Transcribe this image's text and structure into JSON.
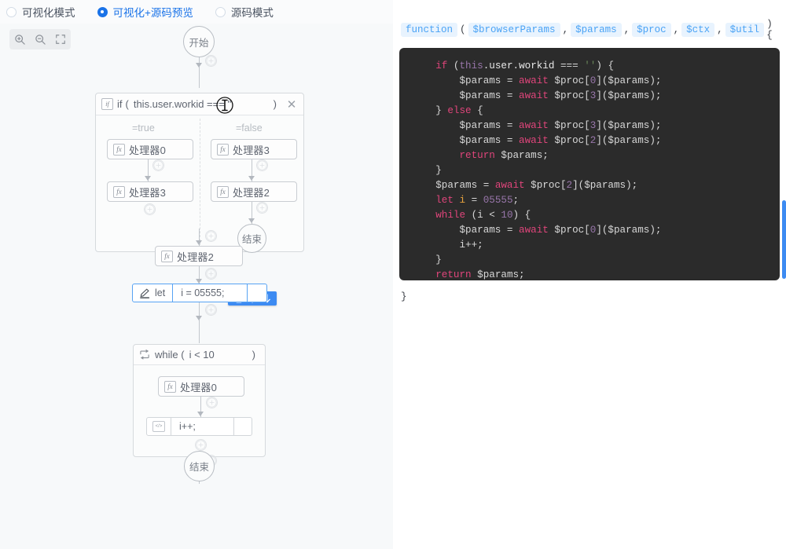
{
  "modes": [
    {
      "label": "可视化模式",
      "selected": false
    },
    {
      "label": "可视化+源码预览",
      "selected": true
    },
    {
      "label": "源码模式",
      "selected": false
    }
  ],
  "toolbar": {
    "zoom_in": "zoom-in",
    "zoom_out": "zoom-out",
    "fit_screen": "fit-screen"
  },
  "flow": {
    "start_label": "开始",
    "end_label": "结束",
    "if": {
      "keyword": "if",
      "paren_open": "(",
      "expression": "this.user.workid === ''",
      "paren_close": ")",
      "close_btn": "✕",
      "true_label": "=true",
      "false_label": "=false",
      "true_branch": [
        {
          "label": "处理器0"
        },
        {
          "label": "处理器3"
        }
      ],
      "false_branch": [
        {
          "label": "处理器3"
        },
        {
          "label": "处理器2"
        }
      ],
      "false_end_label": "结束"
    },
    "after_if_proc": {
      "label": "处理器2"
    },
    "let_stmt": {
      "keyword": "let",
      "value": "i = 05555;"
    },
    "while": {
      "keyword": "while (",
      "condition": "i < 10",
      "paren_close": ")",
      "body_proc": {
        "label": "处理器0"
      },
      "incr_stmt": {
        "value": "i++;"
      }
    },
    "node_toolbar": {
      "copy": "copy-icon",
      "move_up": "arrow-up-icon",
      "move_down": "arrow-down-icon"
    }
  },
  "code": {
    "signature": {
      "fn": "function",
      "open": "(",
      "params": [
        "$browserParams",
        "$params",
        "$proc",
        "$ctx",
        "$util"
      ],
      "comma": ",",
      "close": ") {"
    },
    "lines": [
      "    if (this.user.workid === '') {",
      "        $params = await $proc[0]($params);",
      "        $params = await $proc[3]($params);",
      "    } else {",
      "        $params = await $proc[3]($params);",
      "        $params = await $proc[2]($params);",
      "        return $params;",
      "    }",
      "    $params = await $proc[2]($params);",
      "    let i = 05555;",
      "    while (i < 10) {",
      "        $params = await $proc[0]($params);",
      "        i++;",
      "    }",
      "    return $params;"
    ],
    "closing_brace": "}"
  },
  "colors": {
    "accent": "#1a73e8",
    "toolbar_blue": "#3d8bf2",
    "selected_border": "#57a3f3",
    "code_bg": "#2b2b2b",
    "canvas_bg": "#f7f9fa"
  }
}
